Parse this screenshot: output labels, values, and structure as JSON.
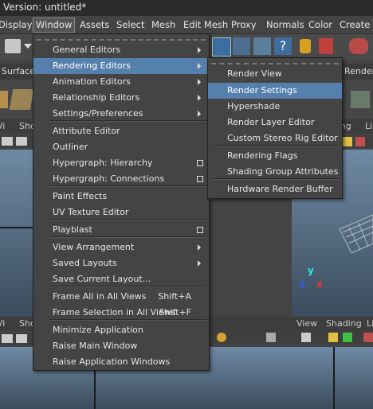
{
  "window": {
    "title": "Version: untitled*"
  },
  "menubar": {
    "items": [
      "Display",
      "Window",
      "Assets",
      "Select",
      "Mesh",
      "Edit Mesh",
      "Proxy",
      "Normals",
      "Color",
      "Create U"
    ]
  },
  "shelf": {
    "tab_left": "Surfaces",
    "tab_right": "Renderi"
  },
  "panels": {
    "left_top_menu": [
      "Vi",
      "Sho"
    ],
    "right_top_menu": [
      "Shading",
      "Li"
    ],
    "left_bottom_menu": [
      "Vi",
      "Sho"
    ],
    "right_bottom_menu": [
      "View",
      "Shading",
      "Li"
    ]
  },
  "axis": {
    "y": "y",
    "z": "z",
    "x": "x"
  },
  "window_menu": {
    "items": [
      {
        "label": "General Editors",
        "submenu": true
      },
      {
        "label": "Rendering Editors",
        "submenu": true,
        "highlighted": true
      },
      {
        "label": "Animation Editors",
        "submenu": true
      },
      {
        "label": "Relationship Editors",
        "submenu": true
      },
      {
        "label": "Settings/Preferences",
        "submenu": true
      },
      {
        "label": "Attribute Editor"
      },
      {
        "label": "Outliner"
      },
      {
        "label": "Hypergraph: Hierarchy",
        "option_box": true
      },
      {
        "label": "Hypergraph: Connections",
        "option_box": true
      },
      {
        "label": "Paint Effects"
      },
      {
        "label": "UV Texture Editor"
      },
      {
        "label": "Playblast",
        "option_box": true
      },
      {
        "label": "View Arrangement",
        "submenu": true
      },
      {
        "label": "Saved Layouts",
        "submenu": true
      },
      {
        "label": "Save Current Layout..."
      },
      {
        "label": "Frame All in All Views",
        "shortcut": "Shift+A"
      },
      {
        "label": "Frame Selection in All Views",
        "shortcut": "Shift+F"
      },
      {
        "label": "Minimize Application"
      },
      {
        "label": "Raise Main Window"
      },
      {
        "label": "Raise Application Windows"
      }
    ]
  },
  "rendering_submenu": {
    "items": [
      {
        "label": "Render View"
      },
      {
        "label": "Render Settings",
        "highlighted": true
      },
      {
        "label": "Hypershade"
      },
      {
        "label": "Render Layer Editor"
      },
      {
        "label": "Custom Stereo Rig Editor"
      },
      {
        "label": "Rendering Flags"
      },
      {
        "label": "Shading Group Attributes"
      },
      {
        "label": "Hardware Render Buffer"
      }
    ]
  },
  "colors": {
    "highlight": "#5680ac",
    "menu_bg": "#444444",
    "viewport_top": "#6f8aa5"
  }
}
